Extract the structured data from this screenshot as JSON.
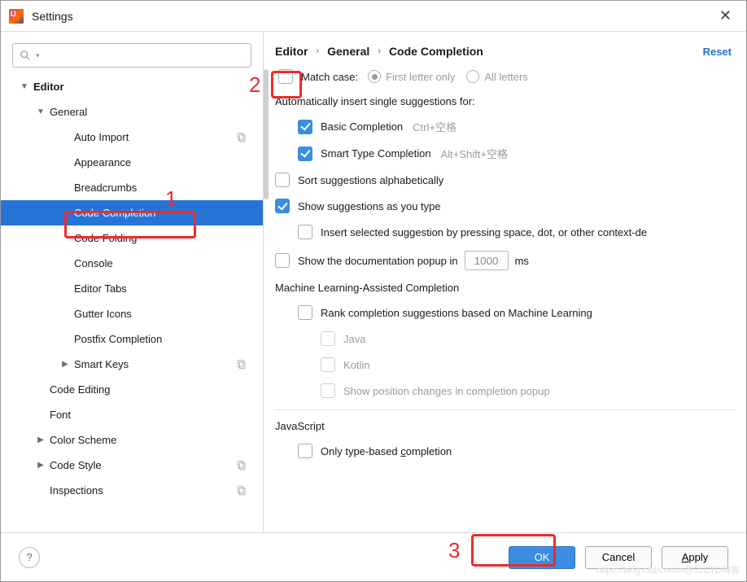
{
  "window": {
    "title": "Settings"
  },
  "search": {
    "placeholder": ""
  },
  "sidebar": {
    "items": [
      {
        "label": "Editor",
        "bold": true,
        "indent": 0,
        "arrow": "down"
      },
      {
        "label": "General",
        "indent": 1,
        "arrow": "down"
      },
      {
        "label": "Auto Import",
        "indent": 2,
        "copy": true
      },
      {
        "label": "Appearance",
        "indent": 2
      },
      {
        "label": "Breadcrumbs",
        "indent": 2
      },
      {
        "label": "Code Completion",
        "indent": 2,
        "selected": true
      },
      {
        "label": "Code Folding",
        "indent": 2
      },
      {
        "label": "Console",
        "indent": 2
      },
      {
        "label": "Editor Tabs",
        "indent": 2
      },
      {
        "label": "Gutter Icons",
        "indent": 2
      },
      {
        "label": "Postfix Completion",
        "indent": 2
      },
      {
        "label": "Smart Keys",
        "indent": 2,
        "arrow": "right",
        "copy": true
      },
      {
        "label": "Code Editing",
        "indent": 1
      },
      {
        "label": "Font",
        "indent": 1
      },
      {
        "label": "Color Scheme",
        "indent": 1,
        "arrow": "right"
      },
      {
        "label": "Code Style",
        "indent": 1,
        "arrow": "right",
        "copy": true
      },
      {
        "label": "Inspections",
        "indent": 1,
        "copy": true
      }
    ]
  },
  "breadcrumb": {
    "a": "Editor",
    "b": "General",
    "c": "Code Completion",
    "reset": "Reset"
  },
  "form": {
    "match_case": "Match case:",
    "first_letter": "First letter only",
    "all_letters": "All letters",
    "auto_insert_heading": "Automatically insert single suggestions for:",
    "basic_completion": "Basic Completion",
    "basic_shortcut": "Ctrl+空格",
    "smart_completion": "Smart Type Completion",
    "smart_shortcut": "Alt+Shift+空格",
    "sort_alpha": "Sort suggestions alphabetically",
    "show_as_type": "Show suggestions as you type",
    "insert_selected": "Insert selected suggestion by pressing space, dot, or other context-de",
    "show_doc_a": "Show the documentation popup in",
    "show_doc_value": "1000",
    "show_doc_b": "ms",
    "ml_heading": "Machine Learning-Assisted Completion",
    "ml_rank": "Rank completion suggestions based on Machine Learning",
    "ml_java": "Java",
    "ml_kotlin": "Kotlin",
    "ml_show_pos": "Show position changes in completion popup",
    "js_heading": "JavaScript",
    "js_only_type_a": "Only type-based ",
    "js_only_type_b": "c",
    "js_only_type_c": "ompletion"
  },
  "footer": {
    "ok": "OK",
    "cancel": "Cancel",
    "apply_a": "A",
    "apply_b": "pply"
  },
  "annotations": {
    "n1": "1",
    "n2": "2",
    "n3": "3"
  },
  "watermark": "https://blog.csdn.net/n@51CTO博客"
}
